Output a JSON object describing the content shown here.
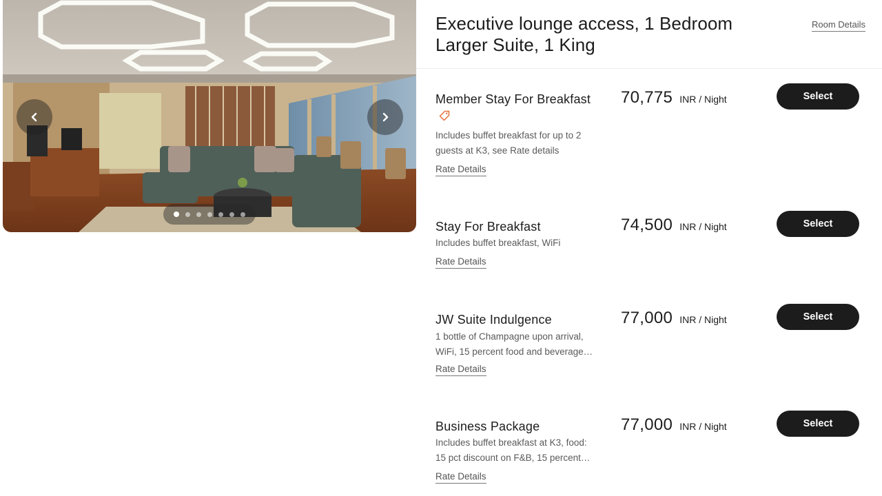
{
  "gallery": {
    "prev_icon": "chevron-left-icon",
    "next_icon": "chevron-right-icon",
    "dot_count": 7,
    "active_dot": 1
  },
  "room": {
    "title_line1": "Executive lounge access, 1 Bedroom",
    "title_line2": "Larger Suite, 1 King",
    "details_link": "Room Details"
  },
  "rates": [
    {
      "name": "Member Stay For Breakfast",
      "has_member_tag": true,
      "tag_color": "#e8703a",
      "desc_lines": [
        "Includes buffet breakfast for up to 2",
        "guests at K3, see Rate details"
      ],
      "link": "Rate Details",
      "price": "70,775",
      "unit": "INR / Night",
      "button": "Select"
    },
    {
      "name": "Stay For Breakfast",
      "has_member_tag": false,
      "desc_lines": [
        "Includes buffet breakfast, WiFi"
      ],
      "link": "Rate Details",
      "price": "74,500",
      "unit": "INR / Night",
      "button": "Select"
    },
    {
      "name": "JW Suite Indulgence",
      "has_member_tag": false,
      "desc_lines": [
        "1 bottle of Champagne upon arrival,",
        "WiFi, 15 percent food and beverage…"
      ],
      "link": "Rate Details",
      "price": "77,000",
      "unit": "INR / Night",
      "button": "Select"
    },
    {
      "name": "Business Package",
      "has_member_tag": false,
      "desc_lines": [
        "Includes buffet breakfast at K3, food:",
        "15 pct discount on F&B, 15 percent…"
      ],
      "link": "Rate Details",
      "price": "77,000",
      "unit": "INR / Night",
      "button": "Select"
    }
  ]
}
